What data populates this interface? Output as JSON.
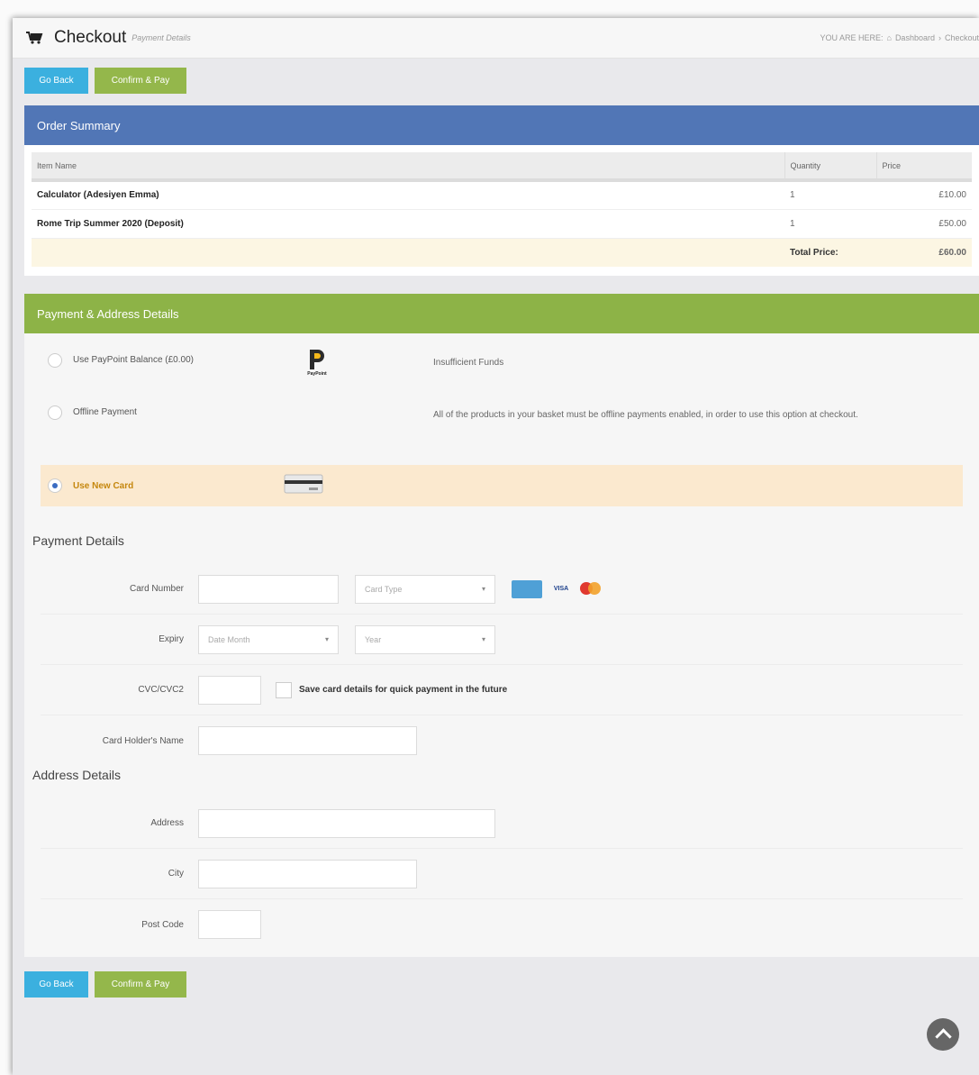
{
  "header": {
    "title": "Checkout",
    "subtitle": "Payment Details",
    "breadcrumb_prefix": "YOU ARE HERE:",
    "breadcrumb_items": [
      "Dashboard",
      "Checkout"
    ]
  },
  "actions": {
    "back_label": "Go Back",
    "confirm_label": "Confirm & Pay"
  },
  "order_summary": {
    "title": "Order Summary",
    "columns": [
      "Item Name",
      "Quantity",
      "Price"
    ],
    "rows": [
      {
        "name": "Calculator (Adesiyen Emma)",
        "quantity": "1",
        "price": "£10.00"
      },
      {
        "name": "Rome Trip Summer 2020 (Deposit)",
        "quantity": "1",
        "price": "£50.00"
      }
    ],
    "total_label": "Total Price:",
    "total_value": "£60.00"
  },
  "payment": {
    "title": "Payment & Address Details",
    "options": [
      {
        "label": "Use PayPoint Balance (£0.00)",
        "note": "Insufficient Funds",
        "icon_text": "PayPoint",
        "selected": false
      },
      {
        "label": "Offline Payment",
        "note": "All of the products in your basket must be offline payments enabled, in order to use this option at checkout.",
        "selected": false
      },
      {
        "label": "Use New Card",
        "note": "",
        "selected": true
      }
    ]
  },
  "payment_details": {
    "title": "Payment Details",
    "card_number_label": "Card Number",
    "card_type_placeholder": "Card Type",
    "card_logos": [
      "amex-icon",
      "visa-icon",
      "mastercard-icon"
    ],
    "visa_text": "VISA",
    "expiry_label": "Expiry",
    "month_placeholder": "Date Month",
    "year_placeholder": "Year",
    "cvc_label": "CVC/CVC2",
    "save_card_label": "Save card details for quick payment in the future",
    "holder_label": "Card Holder's Name"
  },
  "address_details": {
    "title": "Address Details",
    "address_label": "Address",
    "city_label": "City",
    "postcode_label": "Post Code"
  },
  "colors": {
    "order_header": "#5176b6",
    "payment_header": "#8db347",
    "back_button": "#3bb0df",
    "confirm_button": "#94b74b",
    "selected_option_bg": "#fbe9cf"
  }
}
